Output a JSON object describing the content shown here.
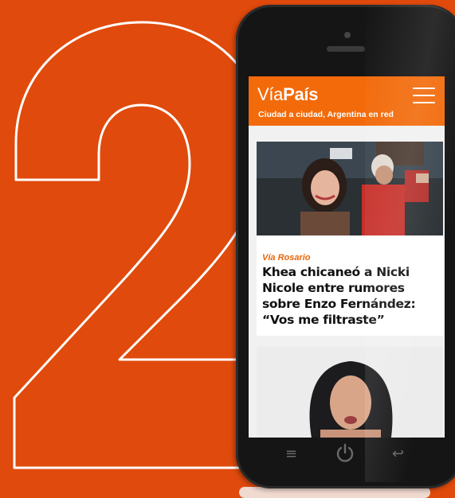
{
  "background_numeral": "2",
  "colors": {
    "background": "#e04a0c",
    "header": "#f26a0a",
    "section": "#e8650a"
  },
  "site": {
    "logo_light": "Vía",
    "logo_bold": "País",
    "tagline": "Ciudad a ciudad, Argentina en red"
  },
  "articles": [
    {
      "section": "Vía Rosario",
      "headline": "Khea chicaneó a Nicki Nicole entre rumores sobre Enzo Fernández: “Vos me filtraste”"
    }
  ],
  "phone_nav": {
    "menu_icon": "menu-icon",
    "home_icon": "power-icon",
    "back_icon": "back-icon"
  }
}
